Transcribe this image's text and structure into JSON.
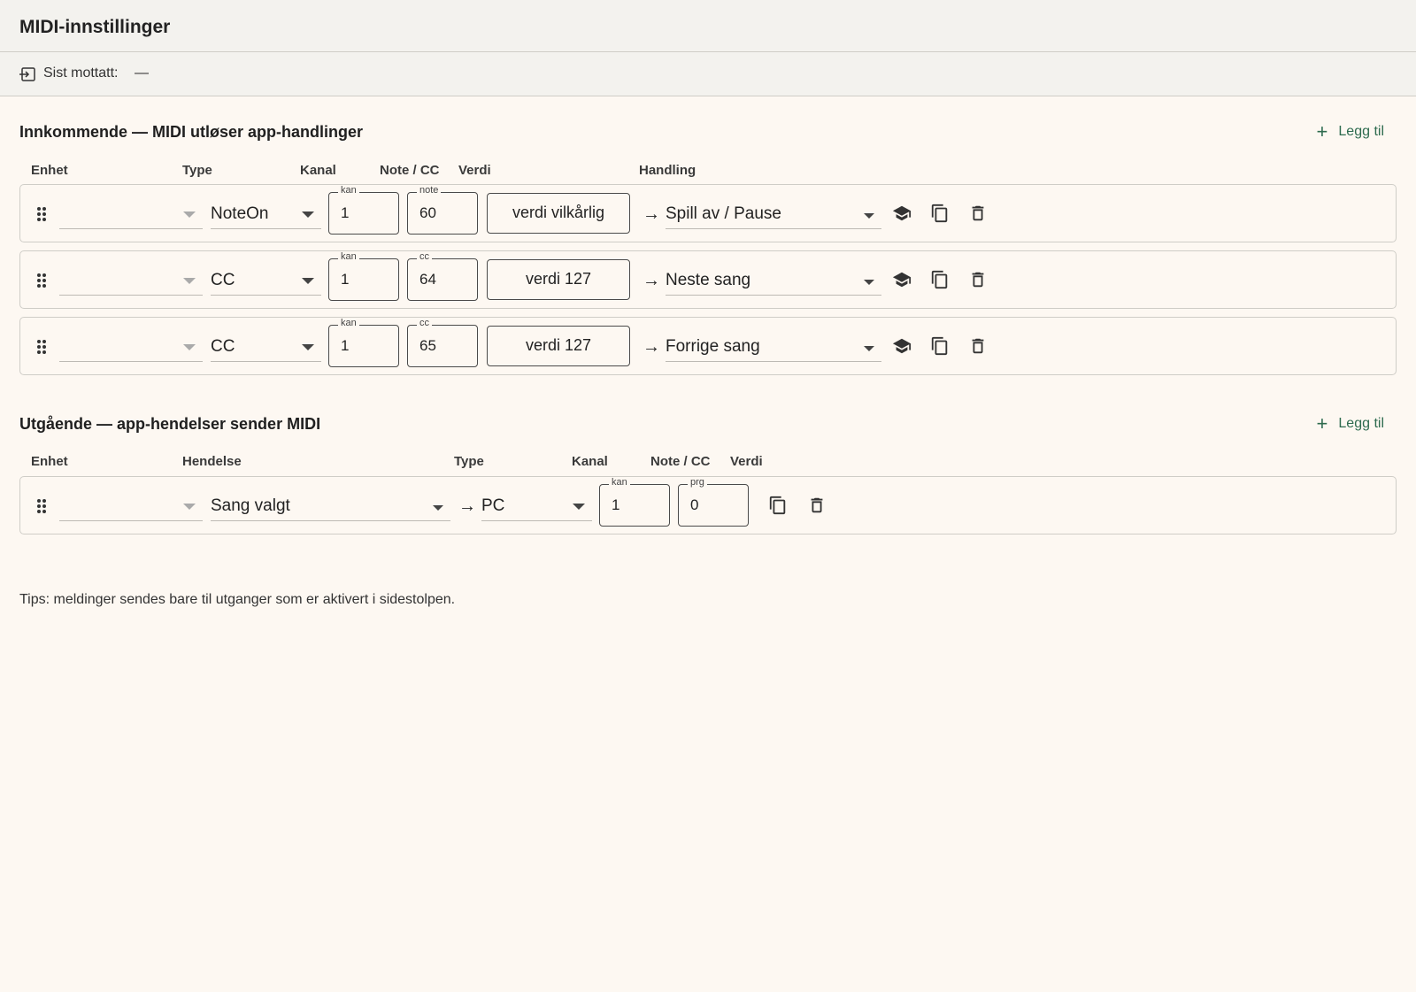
{
  "header": {
    "title": "MIDI-innstillinger"
  },
  "status": {
    "last_received_label": "Sist mottatt:",
    "last_received_value": "—"
  },
  "incoming": {
    "title": "Innkommende — MIDI utløser app-handlinger",
    "add_label": "Legg til",
    "columns": [
      "Enhet",
      "Type",
      "Kanal",
      "Note / CC",
      "Verdi",
      "Handling"
    ],
    "rows": [
      {
        "device": "",
        "type": "NoteOn",
        "channel_legend": "kan",
        "channel": "1",
        "number_legend": "note",
        "number": "60",
        "value": "verdi vilkårlig",
        "action": "Spill av / Pause"
      },
      {
        "device": "",
        "type": "CC",
        "channel_legend": "kan",
        "channel": "1",
        "number_legend": "cc",
        "number": "64",
        "value": "verdi 127",
        "action": "Neste sang"
      },
      {
        "device": "",
        "type": "CC",
        "channel_legend": "kan",
        "channel": "1",
        "number_legend": "cc",
        "number": "65",
        "value": "verdi 127",
        "action": "Forrige sang"
      }
    ]
  },
  "outgoing": {
    "title": "Utgående — app-hendelser sender MIDI",
    "add_label": "Legg til",
    "columns": [
      "Enhet",
      "Hendelse",
      "Type",
      "Kanal",
      "Note / CC",
      "Verdi"
    ],
    "rows": [
      {
        "device": "",
        "event": "Sang valgt",
        "type": "PC",
        "channel_legend": "kan",
        "channel": "1",
        "number_legend": "prg",
        "number": "0"
      }
    ]
  },
  "tip": "Tips: meldinger sendes bare til utganger som er aktivert i sidestolpen.",
  "icons": {
    "drag": "drag-handle-icon",
    "learn": "graduation-cap-icon",
    "duplicate": "copy-icon",
    "delete": "trash-icon",
    "status": "input-icon"
  },
  "colors": {
    "accent": "#2e6b4f",
    "background": "#fdf8f2",
    "bar": "#f3f2ee"
  }
}
